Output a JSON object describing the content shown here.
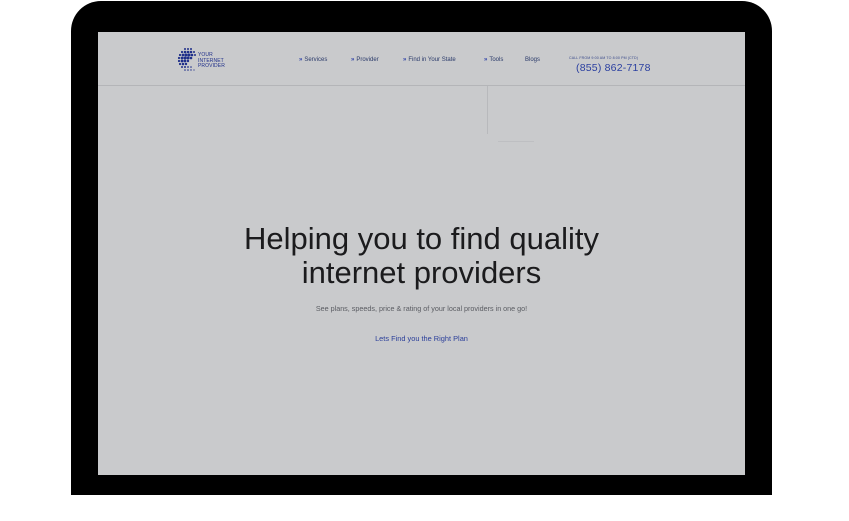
{
  "brand": {
    "logo_lines": [
      "YOUR",
      "INTERNET",
      "PROVIDER"
    ],
    "primary_color": "#2a3fa0",
    "dot_color": "#1f2f8a"
  },
  "nav": {
    "items": [
      {
        "label": "Services",
        "has_arrow": true
      },
      {
        "label": "Provider",
        "has_arrow": true
      },
      {
        "label": "Find in Your State",
        "has_arrow": true
      },
      {
        "label": "Tools",
        "has_arrow": true
      },
      {
        "label": "Blogs",
        "has_arrow": false
      }
    ],
    "arrow_glyph": "»",
    "call_caption": "CALL FROM 9:00 AM TO 8:00 PM (CTD)",
    "phone": "(855) 862-7178"
  },
  "hero": {
    "title_line1": "Helping you to find quality",
    "title_line2": "internet providers",
    "subtitle": "See plans, speeds, price & rating of your local providers in one go!",
    "cta_label": "Lets Find you the Right Plan"
  },
  "colors": {
    "screen_background": "#c9cacc",
    "device_frame": "#000000",
    "title_text": "#1b1b1d",
    "link_text": "#2b3f9a"
  }
}
